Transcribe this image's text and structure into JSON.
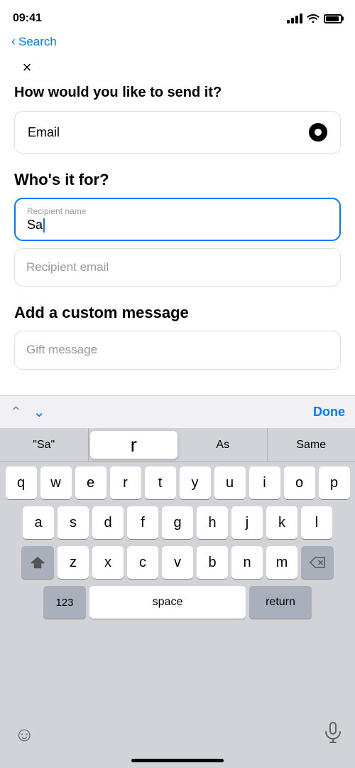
{
  "status": {
    "time": "09:41",
    "back_label": "Search"
  },
  "header": {
    "close_label": "×"
  },
  "form": {
    "send_heading": "How would you like to send it?",
    "email_label": "Email",
    "whos_it_for_heading": "Who's it for?",
    "recipient_name_placeholder": "Recipient name",
    "recipient_name_value": "Sa",
    "recipient_email_placeholder": "Recipient email",
    "add_message_heading": "Add a custom message",
    "gift_message_placeholder": "Gift message"
  },
  "toolbar": {
    "done_label": "Done"
  },
  "autocomplete": {
    "item1": "\"Sa\"",
    "item2": "r",
    "item3": "As",
    "item4": "Same"
  },
  "keyboard": {
    "row1": [
      "q",
      "w",
      "e",
      "r",
      "t",
      "y",
      "u",
      "i",
      "o",
      "p"
    ],
    "row2": [
      "a",
      "s",
      "d",
      "f",
      "g",
      "h",
      "j",
      "k",
      "l"
    ],
    "row3": [
      "z",
      "x",
      "c",
      "v",
      "b",
      "n",
      "m"
    ],
    "space_label": "space",
    "return_label": "return",
    "numbers_label": "123"
  }
}
